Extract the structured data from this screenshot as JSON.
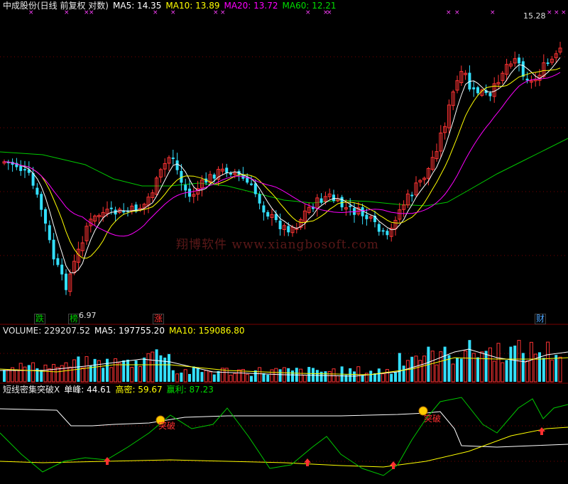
{
  "header": {
    "stock": "中成股份(日线 前复权 对数)",
    "ma5": "MA5: 14.35",
    "ma10": "MA10: 13.89",
    "ma20": "MA20: 13.72",
    "ma60": "MA60: 12.21"
  },
  "volume_header": {
    "volume": "VOLUME: 229207.52",
    "ma5": "MA5: 197755.20",
    "ma10": "MA10: 159086.80"
  },
  "indicator_header": {
    "name": "短线密集突破X",
    "single_peak": "单峰: 44.61",
    "high_density": "高密: 59.67",
    "profit": "赢利: 87.23"
  },
  "watermark": "翔博软件 www.xiangbosoft.com",
  "price_labels": {
    "high": "15.28",
    "low": "6.97"
  },
  "event_marks": [
    {
      "text": "跌",
      "color": "#00cc00"
    },
    {
      "text": "榜",
      "color": "#00cc00"
    },
    {
      "text": "涨",
      "color": "#ff3030"
    },
    {
      "text": "财",
      "color": "#4da6ff"
    }
  ],
  "signal_label": "突破",
  "colors": {
    "up": "#ff3333",
    "down": "#33e0ff",
    "ma5": "#ffffff",
    "ma10": "#ffff00",
    "ma20": "#ff00ff",
    "ma60": "#00c800",
    "grid": "#7a0000"
  },
  "chart_data": [
    {
      "type": "candlestick",
      "title": "中成股份(日线 前复权 对数)",
      "y_range": [
        6.97,
        15.28
      ],
      "series": [
        {
          "name": "MA5",
          "value": 14.35
        },
        {
          "name": "MA10",
          "value": 13.89
        },
        {
          "name": "MA20",
          "value": 13.72
        },
        {
          "name": "MA60",
          "value": 12.21
        }
      ],
      "key_points": [
        {
          "label": "6.97",
          "kind": "low"
        },
        {
          "label": "15.28",
          "kind": "high"
        }
      ]
    },
    {
      "type": "bar",
      "title": "VOLUME",
      "series": [
        {
          "name": "VOLUME",
          "value": 229207.52
        },
        {
          "name": "MA5",
          "value": 197755.2
        },
        {
          "name": "MA10",
          "value": 159086.8
        }
      ]
    },
    {
      "type": "line",
      "title": "短线密集突破X",
      "series": [
        {
          "name": "单峰",
          "value": 44.61
        },
        {
          "name": "高密",
          "value": 59.67
        },
        {
          "name": "赢利",
          "value": 87.23
        }
      ],
      "signals": [
        "突破",
        "突破"
      ]
    }
  ]
}
